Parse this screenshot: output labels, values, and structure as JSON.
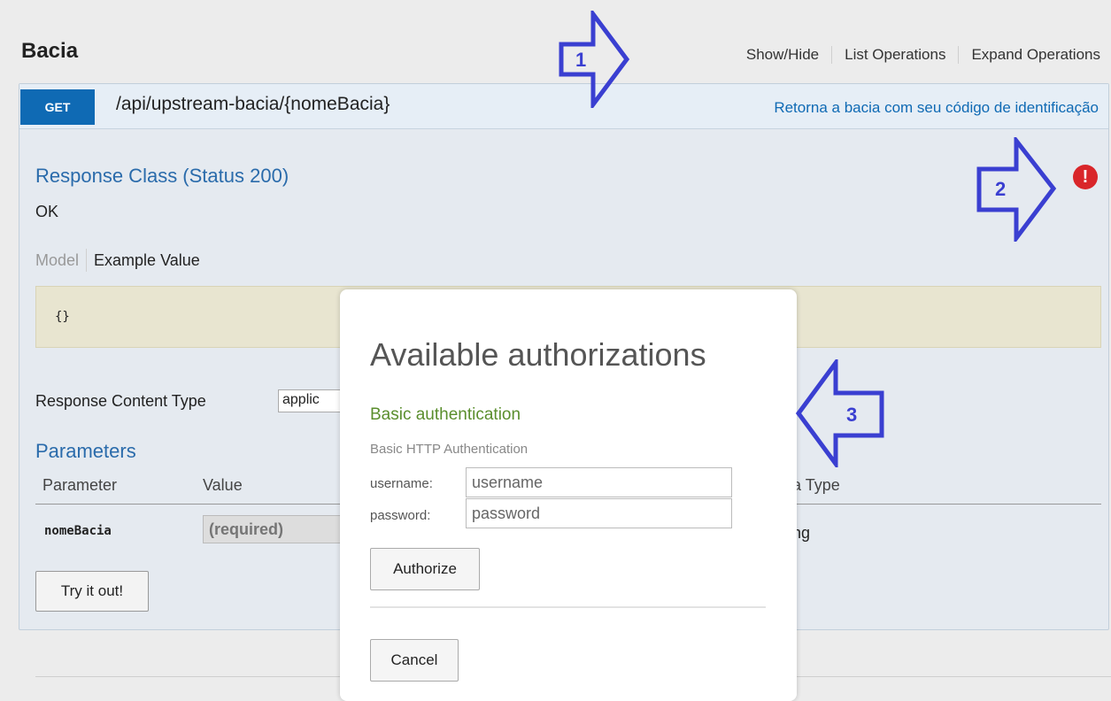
{
  "resource": {
    "title": "Bacia",
    "links": [
      "Show/Hide",
      "List Operations",
      "Expand Operations"
    ]
  },
  "operation": {
    "method": "GET",
    "path": "/api/upstream-bacia/{nomeBacia}",
    "summary": "Retorna a bacia com seu código de identificação",
    "response_class_title": "Response Class (Status 200)",
    "response_status_text": "OK",
    "model_tabs": {
      "model": "Model",
      "example": "Example Value"
    },
    "example_value": "{}",
    "response_content_type_label": "Response Content Type",
    "response_content_type_value": "applic",
    "parameters_title": "Parameters",
    "param_headers": {
      "parameter": "Parameter",
      "value": "Value",
      "data_type": "ata Type"
    },
    "param_row": {
      "name": "nomeBacia",
      "placeholder": "(required)",
      "data_type": "tring"
    },
    "try_button": "Try it out!",
    "warning_icon": "exclamation-circle-icon"
  },
  "modal": {
    "title": "Available authorizations",
    "auth_name": "Basic authentication",
    "auth_description": "Basic HTTP Authentication",
    "username_label": "username:",
    "username_placeholder": "username",
    "password_label": "password:",
    "password_placeholder": "password",
    "authorize_button": "Authorize",
    "cancel_button": "Cancel"
  },
  "annotations": [
    "1",
    "2",
    "3"
  ],
  "colors": {
    "get_badge": "#0f6ab4",
    "heading_blue": "#2a6bab",
    "auth_green": "#5a8e2d",
    "warning_red": "#d9262a",
    "annotation_blue": "#3a3fd1"
  }
}
